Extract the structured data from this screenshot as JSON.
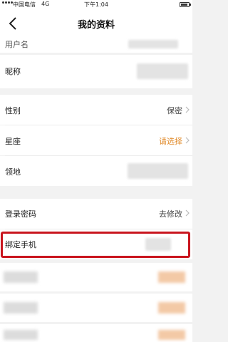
{
  "status_bar": {
    "carrier": "中国电信",
    "network": "4G",
    "time": "下午1:04"
  },
  "nav": {
    "title": "我的资料",
    "back_icon": "chevron-left-icon"
  },
  "fields": {
    "username_label": "用户名",
    "nickname_label": "昵称",
    "gender_label": "性别",
    "gender_value": "保密",
    "zodiac_label": "星座",
    "zodiac_value": "请选择",
    "region_label": "领地",
    "password_label": "登录密码",
    "password_value": "去修改",
    "phone_label": "绑定手机"
  },
  "colors": {
    "accent": "#e08a2a",
    "highlight": "#c9151e"
  }
}
